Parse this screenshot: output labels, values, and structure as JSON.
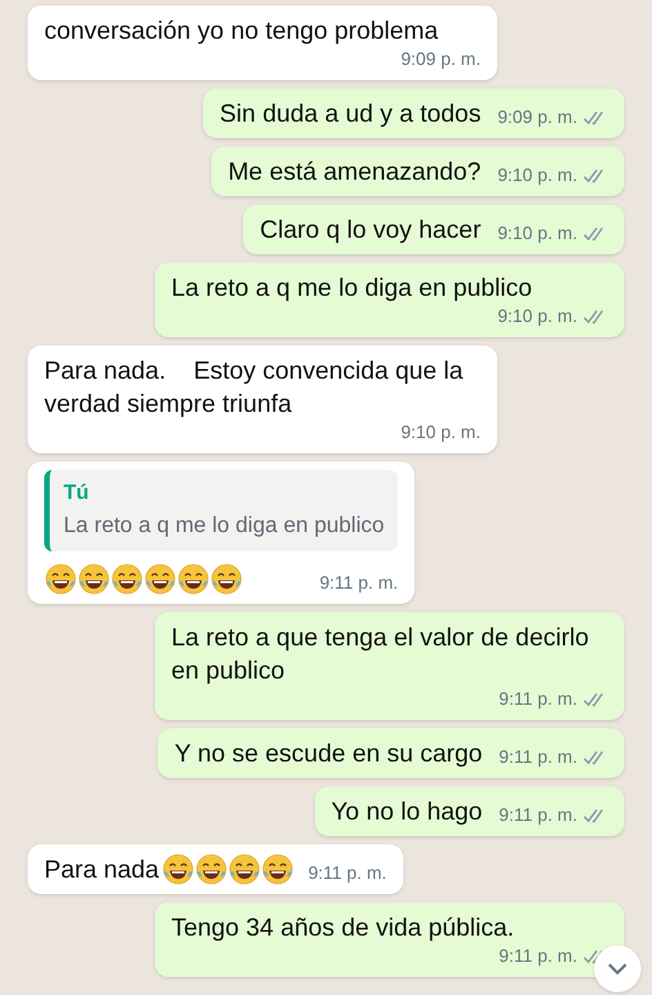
{
  "messages": [
    {
      "kind": "incoming",
      "text": "conversación yo no tengo problema",
      "time": "9:09 p. m."
    },
    {
      "kind": "outgoing",
      "text": "Sin duda a ud y a todos",
      "time": "9:09 p. m.",
      "delivered": true
    },
    {
      "kind": "outgoing",
      "text": "Me está amenazando?",
      "time": "9:10 p. m.",
      "delivered": true
    },
    {
      "kind": "outgoing",
      "text": "Claro q lo voy hacer",
      "time": "9:10 p. m.",
      "delivered": true
    },
    {
      "kind": "outgoing",
      "text": "La reto a q me lo diga en publico",
      "time": "9:10 p. m.",
      "delivered": true
    },
    {
      "kind": "incoming",
      "text": "Para nada.    Estoy convencida que la verdad siempre triunfa",
      "time": "9:10 p. m."
    },
    {
      "kind": "incoming",
      "quote": {
        "author": "Tú",
        "text": "La reto a q me lo diga en publico"
      },
      "emojis": [
        {
          "kind": "tears_of_joy"
        },
        {
          "kind": "tears_of_joy"
        },
        {
          "kind": "tears_of_joy"
        },
        {
          "kind": "tears_of_joy"
        },
        {
          "kind": "tears_of_joy"
        },
        {
          "kind": "tears_of_joy"
        }
      ],
      "time": "9:11 p. m."
    },
    {
      "kind": "outgoing",
      "text": "La reto a que tenga el valor de decirlo en publico",
      "time": "9:11 p. m.",
      "delivered": true
    },
    {
      "kind": "outgoing",
      "text": "Y no se escude en su cargo",
      "time": "9:11 p. m.",
      "delivered": true
    },
    {
      "kind": "outgoing",
      "text": "Yo no lo hago",
      "time": "9:11 p. m.",
      "delivered": true
    },
    {
      "kind": "incoming",
      "text": "Para nada",
      "emojis": [
        {
          "kind": "tears_of_joy"
        },
        {
          "kind": "tears_of_joy"
        },
        {
          "kind": "tears_of_joy"
        },
        {
          "kind": "tears_of_joy"
        }
      ],
      "time": "9:11 p. m."
    },
    {
      "kind": "outgoing",
      "text": "Tengo 34 años de vida pública.",
      "time": "9:11 p. m.",
      "delivered": true
    }
  ]
}
